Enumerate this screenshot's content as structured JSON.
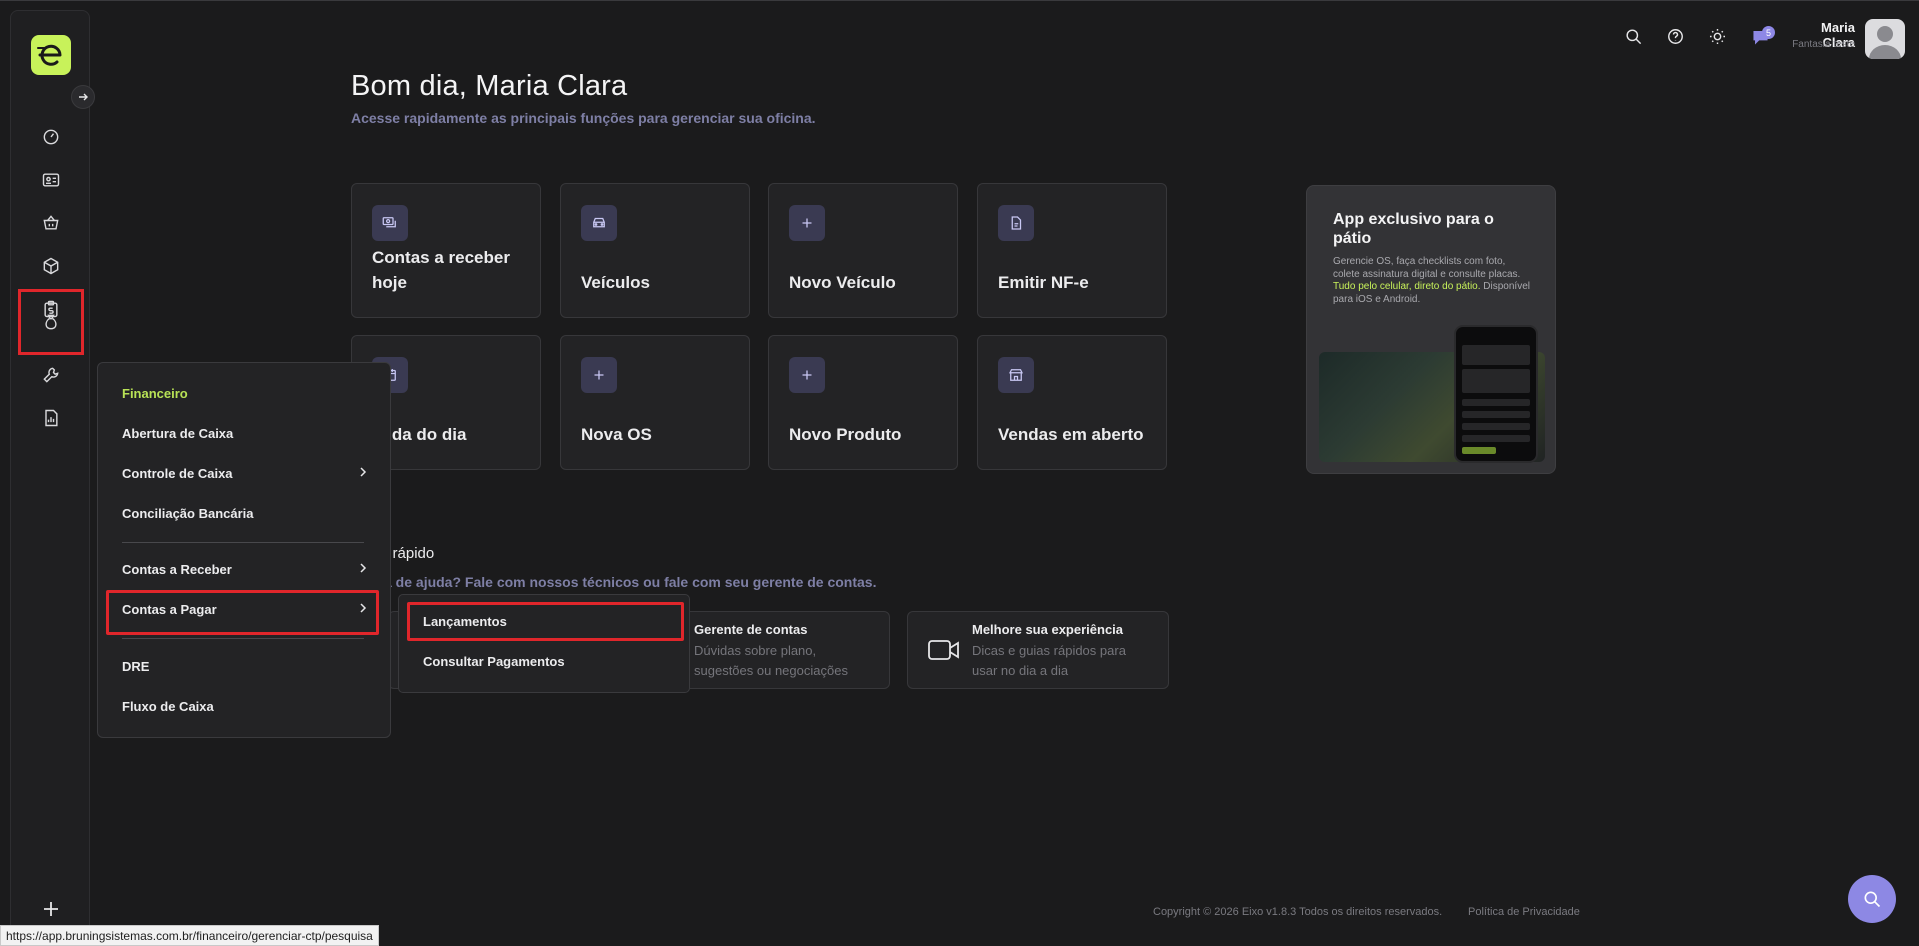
{
  "header": {
    "user_name": "Maria Clara",
    "user_company": "Fantasia teste",
    "notification_count": "5"
  },
  "greeting": {
    "title": "Bom dia, Maria Clara",
    "subtitle": "Acesse rapidamente as principais funções para gerenciar sua oficina."
  },
  "cards": [
    {
      "label": "Contas a receber hoje",
      "icon": "money-stack-icon"
    },
    {
      "label": "Veículos",
      "icon": "car-icon"
    },
    {
      "label": "Novo Veículo",
      "icon": "plus-icon"
    },
    {
      "label": "Emitir NF-e",
      "icon": "document-icon"
    },
    {
      "label": "enda do dia",
      "icon": "calendar-icon"
    },
    {
      "label": "Nova OS",
      "icon": "plus-icon"
    },
    {
      "label": "Novo Produto",
      "icon": "plus-icon"
    },
    {
      "label": "Vendas em aberto",
      "icon": "store-icon"
    }
  ],
  "promo": {
    "title": "App exclusivo para o pátio",
    "text_1": "Gerencie OS, faça checklists com foto, colete assinatura digital e consulte placas. ",
    "text_highlight": "Tudo pelo celular, direto do pátio.",
    "text_2": " Disponível para iOS e Android."
  },
  "quick_help": {
    "title": "o rápido",
    "subtitle": "a de ajuda? Fale com nossos técnicos ou fale com seu gerente de contas.",
    "cards": [
      {
        "title": "Gerente de contas",
        "desc": "Dúvidas sobre plano, sugestões ou negociações"
      },
      {
        "title": "Melhore sua experiência",
        "desc": "Dicas e guias rápidos para usar no dia a dia"
      }
    ]
  },
  "financeiro_menu": {
    "header": "Financeiro",
    "items": [
      "Abertura de Caixa",
      "Controle de Caixa",
      "Conciliação Bancária",
      "Contas a Receber",
      "Contas a Pagar",
      "DRE",
      "Fluxo de Caixa"
    ]
  },
  "submenu": {
    "items": [
      "Lançamentos",
      "Consultar Pagamentos"
    ]
  },
  "footer": {
    "copyright": "Copyright © 2026 Eixo v1.8.3 Todos os direitos reservados.",
    "privacy": "Política de Privacidade"
  },
  "status_bar": {
    "url": "https://app.bruningsistemas.com.br/financeiro/gerenciar-ctp/pesquisa"
  },
  "colors": {
    "accent_green": "#c8f25a",
    "accent_purple": "#8d88e4",
    "highlight_red": "#e0262b"
  }
}
